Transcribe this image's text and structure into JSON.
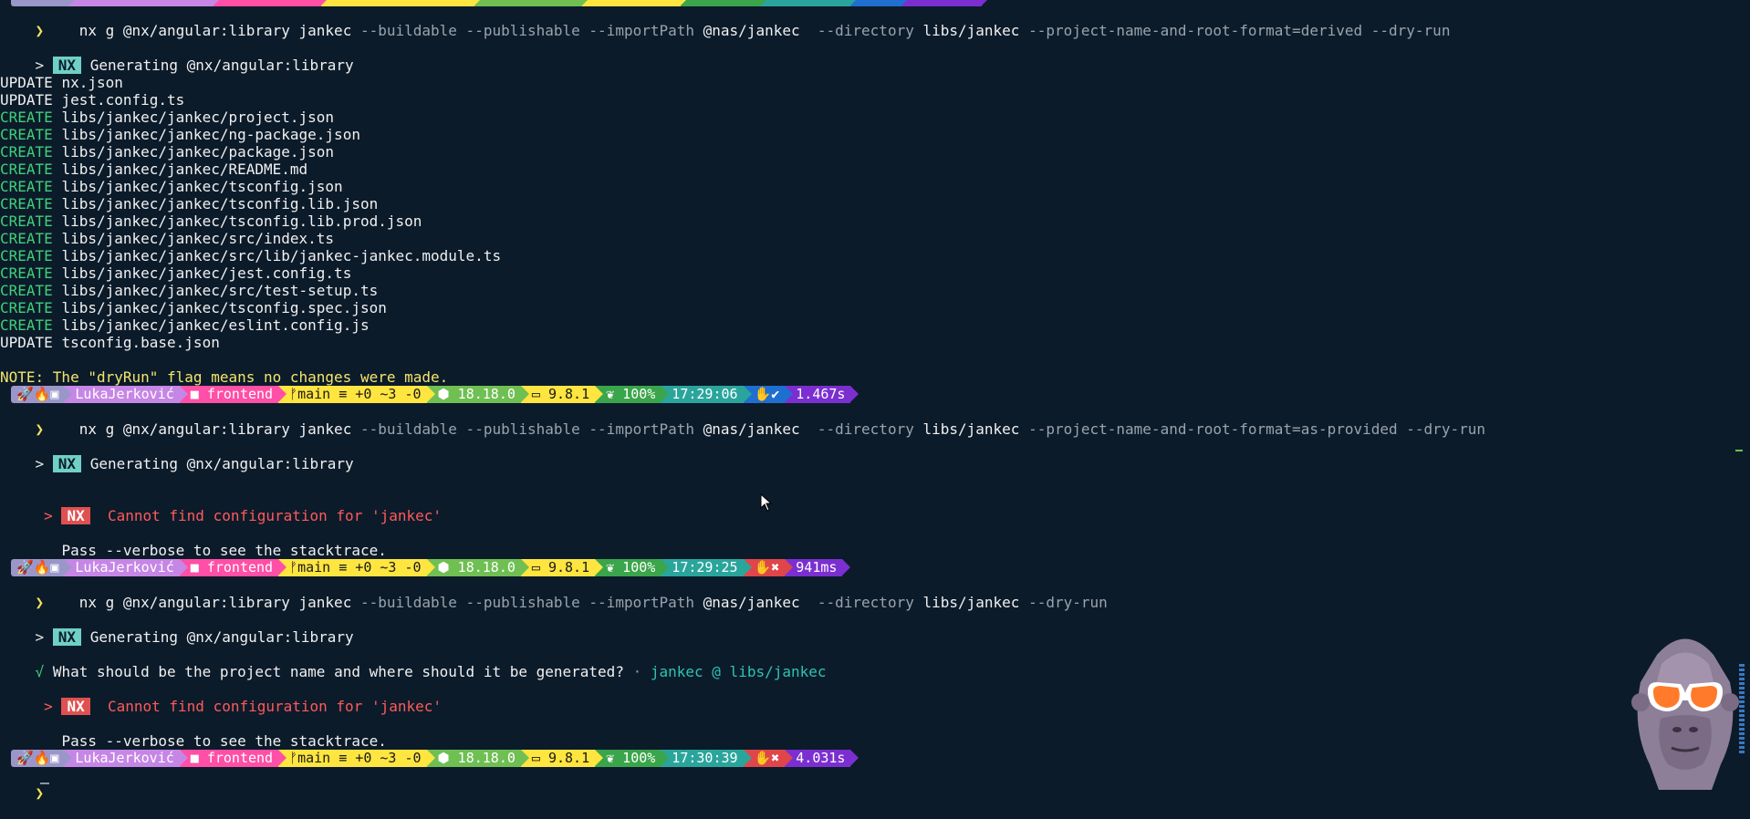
{
  "prompt_symbol": "❯",
  "commands": [
    {
      "cmd": "nx g @nx/angular:library jankec",
      "flags1": " --buildable --publishable --importPath ",
      "import_path": "@nas/jankec",
      "flags2": "  --directory ",
      "directory": "libs/jankec",
      "flags3": " --project-name-and-root-format=derived --dry-run"
    },
    {
      "cmd": "nx g @nx/angular:library jankec",
      "flags1": " --buildable --publishable --importPath ",
      "import_path": "@nas/jankec",
      "flags2": "  --directory ",
      "directory": "libs/jankec",
      "flags3": " --project-name-and-root-format=as-provided --dry-run"
    },
    {
      "cmd": "nx g @nx/angular:library jankec",
      "flags1": " --buildable --publishable --importPath ",
      "import_path": "@nas/jankec",
      "flags2": "  --directory ",
      "directory": "libs/jankec",
      "flags3": " --dry-run"
    }
  ],
  "nx_badge": "NX",
  "generating_text": "Generating @nx/angular:library",
  "file_ops": [
    {
      "op": "UPDATE",
      "path": "nx.json"
    },
    {
      "op": "UPDATE",
      "path": "jest.config.ts"
    },
    {
      "op": "CREATE",
      "path": "libs/jankec/jankec/project.json"
    },
    {
      "op": "CREATE",
      "path": "libs/jankec/jankec/ng-package.json"
    },
    {
      "op": "CREATE",
      "path": "libs/jankec/jankec/package.json"
    },
    {
      "op": "CREATE",
      "path": "libs/jankec/jankec/README.md"
    },
    {
      "op": "CREATE",
      "path": "libs/jankec/jankec/tsconfig.json"
    },
    {
      "op": "CREATE",
      "path": "libs/jankec/jankec/tsconfig.lib.json"
    },
    {
      "op": "CREATE",
      "path": "libs/jankec/jankec/tsconfig.lib.prod.json"
    },
    {
      "op": "CREATE",
      "path": "libs/jankec/jankec/src/index.ts"
    },
    {
      "op": "CREATE",
      "path": "libs/jankec/jankec/src/lib/jankec-jankec.module.ts"
    },
    {
      "op": "CREATE",
      "path": "libs/jankec/jankec/jest.config.ts"
    },
    {
      "op": "CREATE",
      "path": "libs/jankec/jankec/src/test-setup.ts"
    },
    {
      "op": "CREATE",
      "path": "libs/jankec/jankec/tsconfig.spec.json"
    },
    {
      "op": "CREATE",
      "path": "libs/jankec/jankec/eslint.config.js"
    },
    {
      "op": "UPDATE",
      "path": "tsconfig.base.json"
    }
  ],
  "note_text": "NOTE: The \"dryRun\" flag means no changes were made.",
  "error_text": "Cannot find configuration for 'jankec'",
  "verbose_hint": "Pass --verbose to see the stacktrace.",
  "question": {
    "check": "√",
    "text": "What should be the project name and where should it be generated?",
    "sep": " · ",
    "answer": "jankec @ libs/jankec"
  },
  "status_bars": [
    {
      "icons": "🚀🔥▣",
      "user": "LukaJerković",
      "dir": "■ frontend",
      "git": "ᚠmain ≡ +0 ~3 -0",
      "node": "⬢ 18.18.0",
      "npm": "▭ 9.8.1",
      "battery": "❦ 100%",
      "time": "17:29:06",
      "status": "✋✔",
      "exec": "1.467s",
      "error": false
    },
    {
      "icons": "🚀🔥▣",
      "user": "LukaJerković",
      "dir": "■ frontend",
      "git": "ᚠmain ≡ +0 ~3 -0",
      "node": "⬢ 18.18.0",
      "npm": "▭ 9.8.1",
      "battery": "❦ 100%",
      "time": "17:29:25",
      "status": "✋✖",
      "exec": "941ms",
      "error": true
    },
    {
      "icons": "🚀🔥▣",
      "user": "LukaJerković",
      "dir": "■ frontend",
      "git": "ᚠmain ≡ +0 ~3 -0",
      "node": "⬢ 18.18.0",
      "npm": "▭ 9.8.1",
      "battery": "❦ 100%",
      "time": "17:30:39",
      "status": "✋✖",
      "exec": "4.031s",
      "error": true
    }
  ],
  "colors": {
    "background": "#0c1b2a",
    "prompt": "#f2e35c",
    "create": "#3fd07a",
    "note": "#f3e56b",
    "error": "#ff5a5a",
    "answer": "#2cc4b4"
  },
  "icons": [
    "prompt-chevron-icon",
    "mouse-pointer-icon",
    "gorilla-avatar-icon"
  ]
}
